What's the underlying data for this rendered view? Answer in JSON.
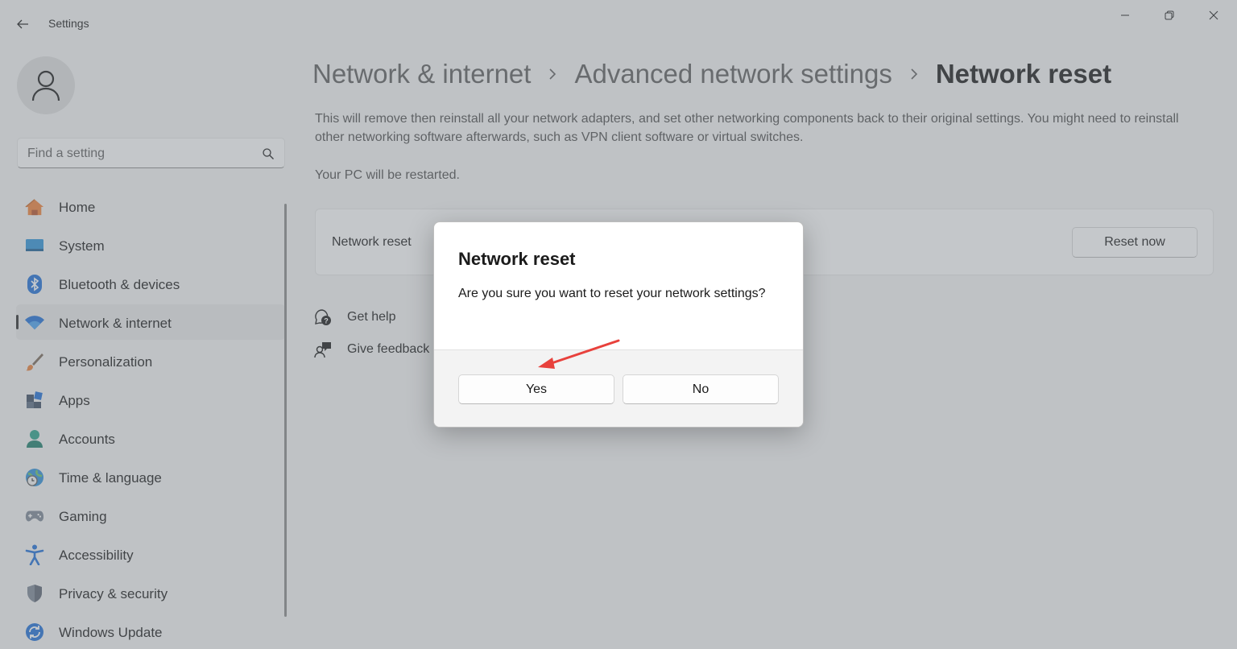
{
  "window": {
    "title": "Settings"
  },
  "sidebar": {
    "search_placeholder": "Find a setting",
    "items": [
      {
        "label": "Home",
        "icon": "home-icon"
      },
      {
        "label": "System",
        "icon": "system-icon"
      },
      {
        "label": "Bluetooth & devices",
        "icon": "bluetooth-icon"
      },
      {
        "label": "Network & internet",
        "icon": "wifi-icon",
        "active": true
      },
      {
        "label": "Personalization",
        "icon": "brush-icon"
      },
      {
        "label": "Apps",
        "icon": "apps-icon"
      },
      {
        "label": "Accounts",
        "icon": "accounts-icon"
      },
      {
        "label": "Time & language",
        "icon": "time-language-icon"
      },
      {
        "label": "Gaming",
        "icon": "gamepad-icon"
      },
      {
        "label": "Accessibility",
        "icon": "accessibility-icon"
      },
      {
        "label": "Privacy & security",
        "icon": "shield-icon"
      },
      {
        "label": "Windows Update",
        "icon": "update-icon"
      }
    ]
  },
  "breadcrumb": {
    "items": [
      "Network & internet",
      "Advanced network settings",
      "Network reset"
    ]
  },
  "main": {
    "description": "This will remove then reinstall all your network adapters, and set other networking components back to their original settings. You might need to reinstall other networking software afterwards, such as VPN client software or virtual switches.",
    "restart_note": "Your PC will be restarted.",
    "card": {
      "label": "Network reset",
      "button": "Reset now"
    },
    "links": {
      "get_help": "Get help",
      "give_feedback": "Give feedback"
    }
  },
  "dialog": {
    "title": "Network reset",
    "message": "Are you sure you want to reset your network settings?",
    "yes": "Yes",
    "no": "No"
  },
  "colors": {
    "accent": "#0067c0",
    "annotation_arrow": "#e8413c",
    "overlay": "#787e86"
  }
}
